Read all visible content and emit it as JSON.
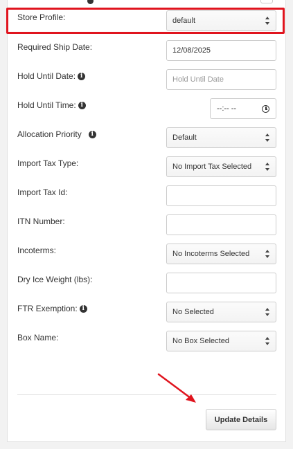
{
  "form": {
    "fields": [
      {
        "label": "Store Profile:",
        "type": "select",
        "value": "default",
        "info": false
      },
      {
        "label": "Required Ship Date:",
        "type": "input",
        "value": "12/08/2025",
        "info": false
      },
      {
        "label": "Hold Until Date:",
        "type": "input",
        "placeholder": "Hold Until Date",
        "info": true
      },
      {
        "label": "Hold Until Time:",
        "type": "time",
        "value": "--:-- --",
        "info": true
      },
      {
        "label": "Allocation Priority",
        "type": "select",
        "value": "Default",
        "info": true
      },
      {
        "label": "Import Tax Type:",
        "type": "select",
        "value": "No Import Tax Selected",
        "info": false
      },
      {
        "label": "Import Tax Id:",
        "type": "input",
        "value": "",
        "info": false
      },
      {
        "label": "ITN Number:",
        "type": "input",
        "value": "",
        "info": false
      },
      {
        "label": "Incoterms:",
        "type": "select",
        "value": "No Incoterms Selected",
        "info": false
      },
      {
        "label": "Dry Ice Weight (lbs):",
        "type": "input",
        "value": "",
        "info": false
      },
      {
        "label": "FTR Exemption:",
        "type": "select",
        "value": "No Selected",
        "info": true
      },
      {
        "label": "Box Name:",
        "type": "select",
        "value": "No Box Selected",
        "info": false
      }
    ],
    "info_icon_glyph": "i",
    "update_button_label": "Update Details"
  },
  "annotations": {
    "highlight_color": "#e0141e",
    "arrow_color": "#e0141e"
  }
}
